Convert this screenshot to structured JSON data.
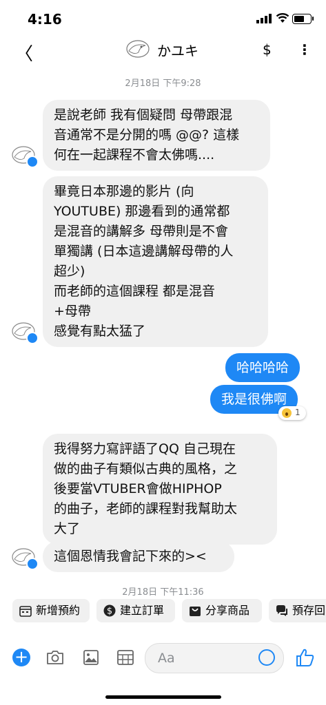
{
  "status_bar": {
    "time": "4:16"
  },
  "header": {
    "back": "〈",
    "contact_name": "かユキ",
    "dollar": "$",
    "more": "⋮"
  },
  "timestamps": [
    "2月18日 下午9:28",
    "2月18日 下午11:36"
  ],
  "messages_in_1": [
    {
      "lines": [
        "是說老師 我有個疑問 母帶跟混",
        "音通常不是分開的嗎 @@? 這樣",
        "何在一起課程不會太佛嗎...."
      ]
    },
    {
      "lines": [
        "畢竟日本那邊的影片 (向",
        "YOUTUBE) 那邊看到的通常都",
        "是混音的講解多 母帶則是不會",
        "單獨講 (日本這邊講解母帶的人",
        "超少)",
        "而老師的這個課程 都是混音",
        "+母帶",
        "感覺有點太猛了"
      ]
    }
  ],
  "messages_out": [
    "哈哈哈哈",
    "我是很佛啊"
  ],
  "reaction": {
    "emoji": "wow-emoji",
    "count": "1"
  },
  "messages_in_2": [
    {
      "lines": [
        "我得努力寫評語了QQ 自己現在",
        "做的曲子有類似古典的風格，之",
        "後要當VTUBER會做HIPHOP",
        "的曲子，老師的課程對我幫助太",
        "大了"
      ]
    },
    {
      "lines": [
        "這個恩情我會記下來的><"
      ]
    }
  ],
  "quick_actions": [
    {
      "label": "新增預約",
      "icon": "calendar-icon"
    },
    {
      "label": "建立訂單",
      "icon": "dollar-icon"
    },
    {
      "label": "分享商品",
      "icon": "bag-icon"
    },
    {
      "label": "預存回",
      "icon": "chat-icon"
    }
  ],
  "composer": {
    "placeholder": "Aa"
  },
  "colors": {
    "accent": "#1e88f5",
    "bubble_in": "#f0f0f0",
    "timestamp": "#8a8d91"
  }
}
